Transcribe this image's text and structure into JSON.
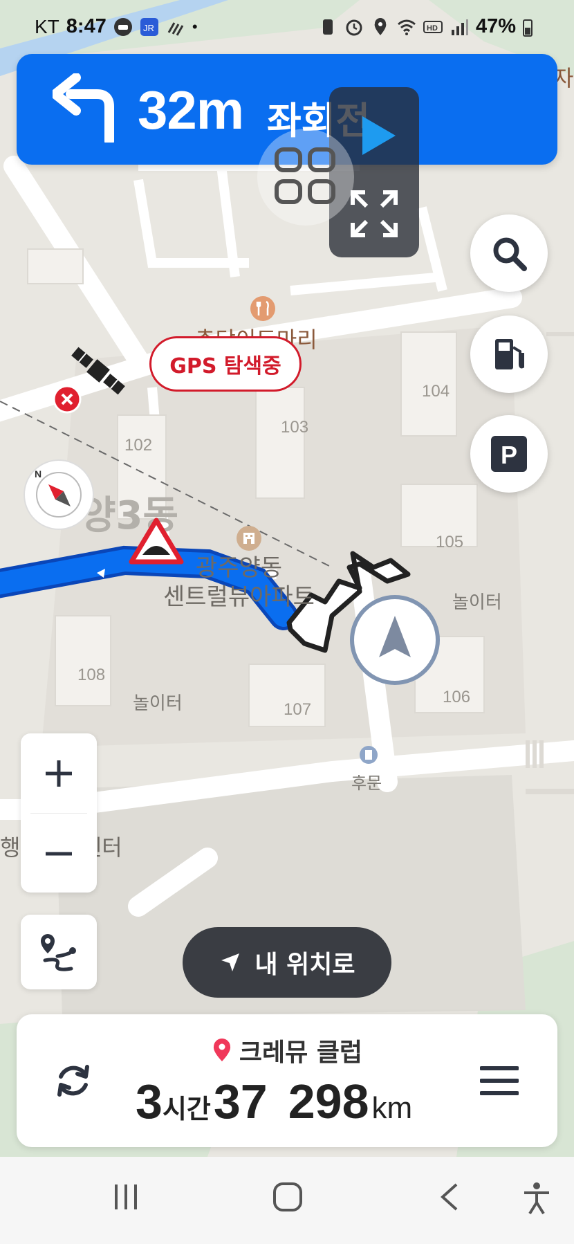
{
  "status_bar": {
    "carrier": "KT",
    "time": "8:47",
    "battery": "47%",
    "icons": [
      "car-icon",
      "tmap-icon",
      "signal-dots-icon",
      "dot-icon",
      "nfc-icon",
      "alarm-icon",
      "location-icon",
      "wifi-icon",
      "hd-icon",
      "cell-signal-icon",
      "battery-icon"
    ]
  },
  "guidance": {
    "distance": "32m",
    "direction": "좌회전",
    "turn_icon": "turn-left-icon"
  },
  "map": {
    "labels": {
      "restaurant": "춘당이도마리",
      "dong": "양3동",
      "apartment_line1": "광주양동",
      "apartment_line2": "센트럴뷰아파트",
      "playground_right": "놀이터",
      "playground_left": "놀이터",
      "back_gate": "후문",
      "center": "행정복지센터",
      "right_edge": "자"
    },
    "buildings": [
      "102",
      "103",
      "104",
      "105",
      "106",
      "107",
      "108"
    ],
    "gps_status": "GPS 탐색중"
  },
  "controls": {
    "zoom_in": "+",
    "zoom_out": "−",
    "my_location": "내 위치로",
    "right_buttons": [
      "search-icon",
      "gas-station-icon",
      "parking-icon"
    ]
  },
  "trip": {
    "destination": "크레뮤 클럽",
    "hours": "3",
    "hours_unit": "시간",
    "minutes": "37",
    "distance": "298",
    "distance_unit": "km"
  },
  "colors": {
    "banner": "#0a6ef0",
    "route": "#0a6ef0",
    "alert": "#d21b2b"
  }
}
